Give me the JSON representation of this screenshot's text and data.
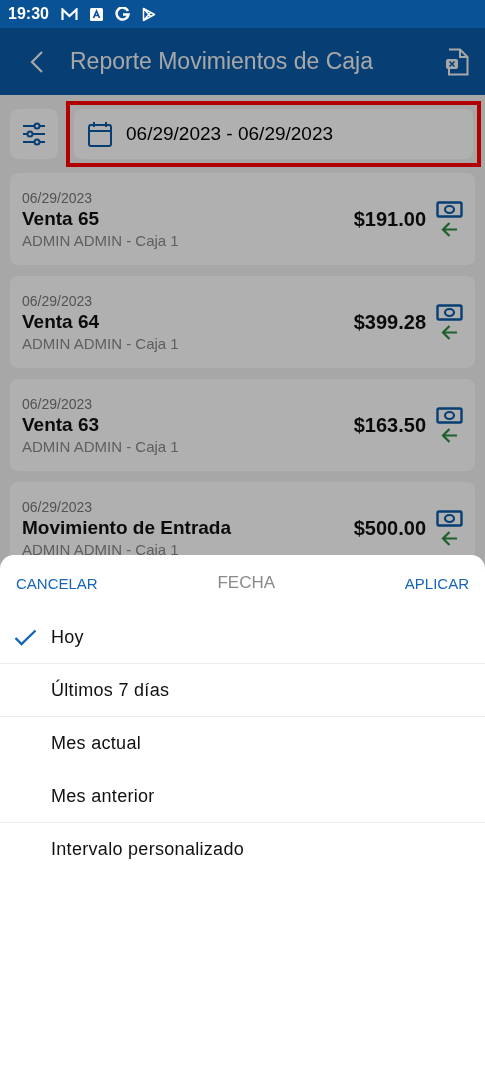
{
  "status_bar": {
    "time": "19:30"
  },
  "app_bar": {
    "title": "Reporte Movimientos de Caja"
  },
  "date_filter": {
    "value": "06/29/2023 - 06/29/2023",
    "highlighted": true
  },
  "movements": [
    {
      "date": "06/29/2023",
      "title": "Venta 65",
      "subtitle": "ADMIN ADMIN - Caja 1",
      "amount": "$191.00",
      "kind": "income"
    },
    {
      "date": "06/29/2023",
      "title": "Venta 64",
      "subtitle": "ADMIN ADMIN - Caja 1",
      "amount": "$399.28",
      "kind": "income"
    },
    {
      "date": "06/29/2023",
      "title": "Venta 63",
      "subtitle": "ADMIN ADMIN - Caja 1",
      "amount": "$163.50",
      "kind": "income"
    },
    {
      "date": "06/29/2023",
      "title": "Movimiento de Entrada",
      "subtitle": "ADMIN ADMIN - Caja 1",
      "amount": "$500.00",
      "kind": "income"
    }
  ],
  "sheet": {
    "cancel": "CANCELAR",
    "title": "FECHA",
    "apply": "APLICAR",
    "options": [
      {
        "label": "Hoy",
        "selected": true,
        "divider_below": true
      },
      {
        "label": "Últimos 7 días",
        "selected": false,
        "divider_below": true
      },
      {
        "label": "Mes actual",
        "selected": false,
        "divider_below": false
      },
      {
        "label": "Mes anterior",
        "selected": false,
        "divider_below": true
      },
      {
        "label": "Intervalo personalizado",
        "selected": false,
        "divider_below": false
      }
    ]
  }
}
